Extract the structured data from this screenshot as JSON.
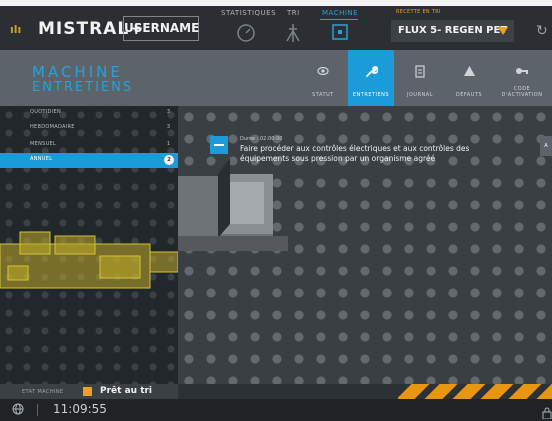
{
  "topbar": {
    "brand": "MISTRAL+",
    "username": "USERNAME",
    "nav": [
      {
        "label": "STATISTIQUES",
        "icon": "gauge-icon",
        "active": false
      },
      {
        "label": "TRI",
        "icon": "sorting-tower-icon",
        "active": false
      },
      {
        "label": "MACHINE",
        "icon": "machine-icon",
        "active": true
      }
    ],
    "recipe_title": "RECETTE EN TRI",
    "recipe_value": "FLUX 5- REGEN PET",
    "accent_color": "#f0a020"
  },
  "header": {
    "title": "MACHINE",
    "subtitle": "ENTRETIENS",
    "tabs": [
      {
        "label": "STATUT",
        "icon": "eye-icon",
        "active": false
      },
      {
        "label": "ENTRETIENS",
        "icon": "wrench-icon",
        "active": true
      },
      {
        "label": "JOURNAL",
        "icon": "clipboard-icon",
        "active": false
      },
      {
        "label": "DÉFAUTS",
        "icon": "warning-icon",
        "active": false
      },
      {
        "label_line1": "CODE",
        "label_line2": "D'ACTIVATION",
        "icon": "key-icon",
        "active": false
      }
    ],
    "accent_color": "#1b9bd8"
  },
  "maintenance": {
    "periods": [
      {
        "label": "QUOTIDIEN",
        "count": "3",
        "active": false
      },
      {
        "label": "HEBDOMADAIRE",
        "count": "3",
        "active": false
      },
      {
        "label": "MENSUEL",
        "count": "1",
        "active": false
      },
      {
        "label": "ANNUEL",
        "count": "2",
        "active": true
      }
    ],
    "task": {
      "duration": "Durée : 02:00:00",
      "text": "Faire procéder aux contrôles électriques et aux contrôles des équipements sous pression par un organisme agréé"
    },
    "side_button": "A"
  },
  "status": {
    "label": "ETAT MACHINE",
    "text": "Prêt au tri",
    "color": "#f0a020"
  },
  "bottombar": {
    "time": "11:09:55"
  }
}
